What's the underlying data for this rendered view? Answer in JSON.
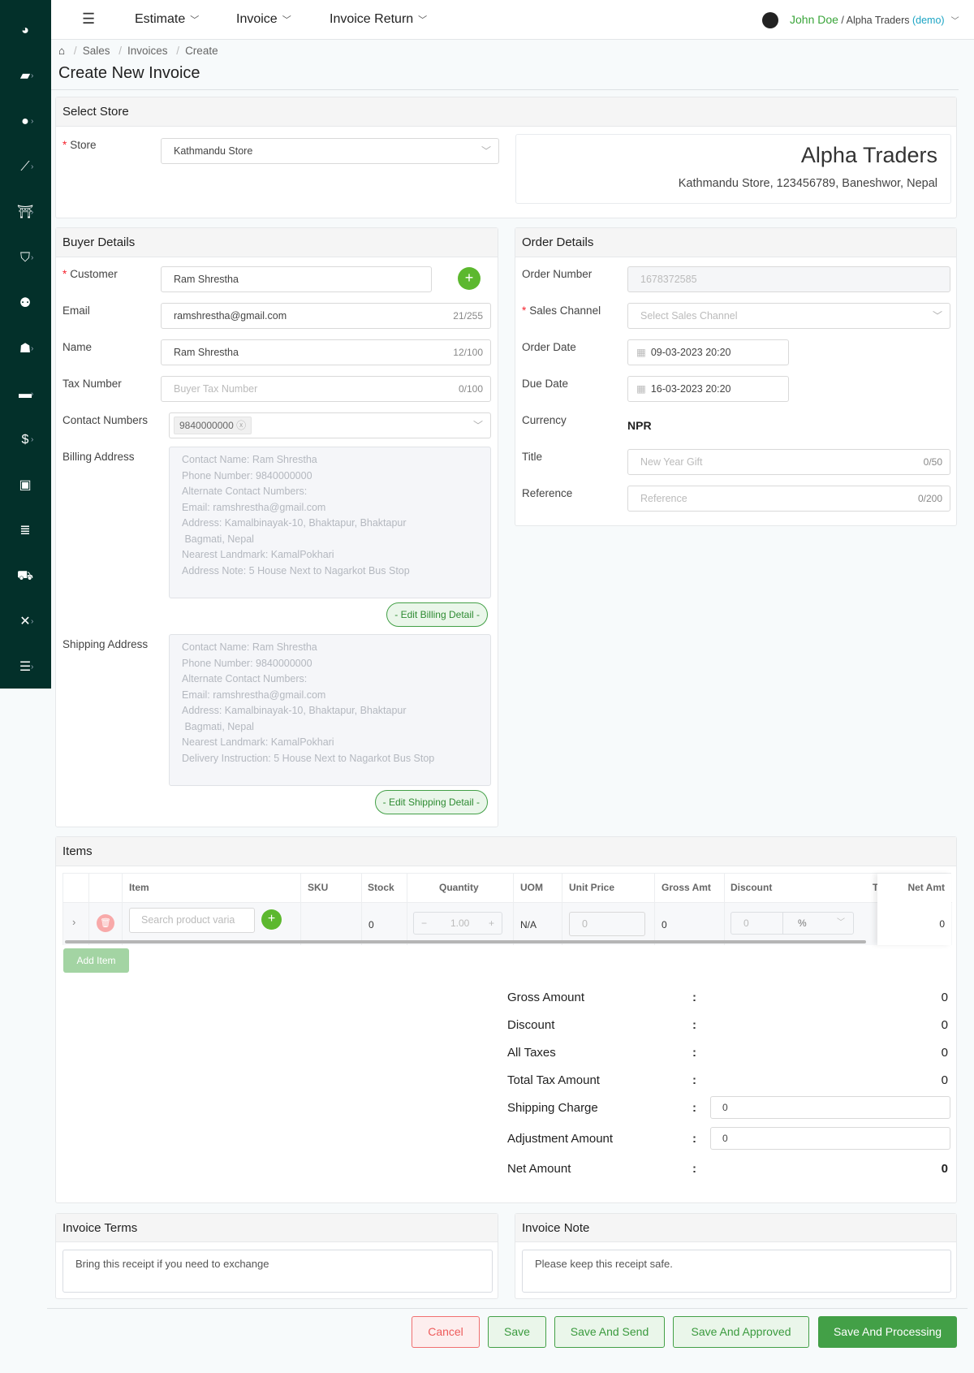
{
  "sidebar": {
    "icons": [
      "dashboard-icon",
      "catalog-icon",
      "user-icon",
      "chart-icon",
      "store-icon",
      "basket-icon",
      "users-group-icon",
      "employee-icon",
      "wallet-icon",
      "payment-icon",
      "box-icon",
      "report-icon",
      "truck-icon",
      "tools-icon",
      "checklist-icon"
    ],
    "color": "#03302a"
  },
  "header": {
    "menus": [
      "Estimate",
      "Invoice",
      "Invoice Return"
    ],
    "user": "John Doe",
    "company": " / Alpha Traders ",
    "demo": "(demo)"
  },
  "breadcrumb": [
    "Sales",
    "Invoices",
    "Create"
  ],
  "page_title": "Create New Invoice",
  "store": {
    "title": "Select Store",
    "label": "Store",
    "value": "Kathmandu Store",
    "company": "Alpha Traders",
    "address": "Kathmandu Store, 123456789, Baneshwor, Nepal"
  },
  "buyer": {
    "title": "Buyer Details",
    "customer_label": "Customer",
    "customer": "Ram Shrestha",
    "email_label": "Email",
    "email": "ramshrestha@gmail.com",
    "email_count": "21/255",
    "name_label": "Name",
    "name": "Ram Shrestha",
    "name_count": "12/100",
    "tax_label": "Tax Number",
    "tax_placeholder": "Buyer Tax Number",
    "tax_count": "0/100",
    "contact_label": "Contact Numbers",
    "contact_tag": "9840000000",
    "billing_label": "Billing Address",
    "billing": [
      "Contact Name: Ram Shrestha",
      "Phone Number: 9840000000",
      "Alternate Contact Numbers:",
      "Email: ramshrestha@gmail.com",
      "Address: Kamalbinayak-10, Bhaktapur, Bhaktapur",
      " Bagmati, Nepal",
      "Nearest Landmark: KamalPokhari",
      "Address Note: 5 House Next to Nagarkot Bus Stop"
    ],
    "edit_billing": "- Edit Billing Detail -",
    "shipping_label": "Shipping Address",
    "shipping": [
      "Contact Name: Ram Shrestha",
      "Phone Number: 9840000000",
      "Alternate Contact Numbers:",
      "Email: ramshrestha@gmail.com",
      "Address: Kamalbinayak-10, Bhaktapur, Bhaktapur",
      " Bagmati, Nepal",
      "Nearest Landmark: KamalPokhari",
      "Delivery Instruction: 5 House Next to Nagarkot Bus Stop"
    ],
    "edit_shipping": "- Edit Shipping Detail -"
  },
  "order": {
    "title": "Order Details",
    "number_label": "Order Number",
    "number": "1678372585",
    "channel_label": "Sales Channel",
    "channel_placeholder": "Select Sales Channel",
    "date_label": "Order Date",
    "date": "09-03-2023 20:20",
    "due_label": "Due Date",
    "due": "16-03-2023 20:20",
    "currency_label": "Currency",
    "currency": "NPR",
    "title_label": "Title",
    "title_placeholder": "New Year Gift",
    "title_count": "0/50",
    "ref_label": "Reference",
    "ref_placeholder": "Reference",
    "ref_count": "0/200"
  },
  "items": {
    "title": "Items",
    "columns": [
      "Item",
      "SKU",
      "Stock",
      "Quantity",
      "UOM",
      "Unit Price",
      "Gross Amt",
      "Discount",
      "T",
      "Net Amt"
    ],
    "row": {
      "search_placeholder": "Search product varia",
      "stock": "0",
      "quantity": "1.00",
      "uom": "N/A",
      "unit_price": "0",
      "gross": "0",
      "discount": "0",
      "discount_type": "%",
      "net": "0"
    },
    "add_item": "Add Item"
  },
  "totals": [
    {
      "label": "Gross Amount",
      "value": "0"
    },
    {
      "label": "Discount",
      "value": "0"
    },
    {
      "label": "All Taxes",
      "value": "0"
    },
    {
      "label": "Total Tax Amount",
      "value": "0"
    },
    {
      "label": "Shipping Charge",
      "value": "0"
    },
    {
      "label": "Adjustment Amount",
      "value": "0"
    },
    {
      "label": "Net Amount",
      "value": "0"
    }
  ],
  "terms": {
    "title": "Invoice Terms",
    "value": "Bring this receipt if you need to exchange"
  },
  "note": {
    "title": "Invoice Note",
    "value": "Please keep this receipt safe."
  },
  "actions": {
    "cancel": "Cancel",
    "save": "Save",
    "send": "Save And Send",
    "approved": "Save And Approved",
    "processing": "Save And Processing"
  }
}
